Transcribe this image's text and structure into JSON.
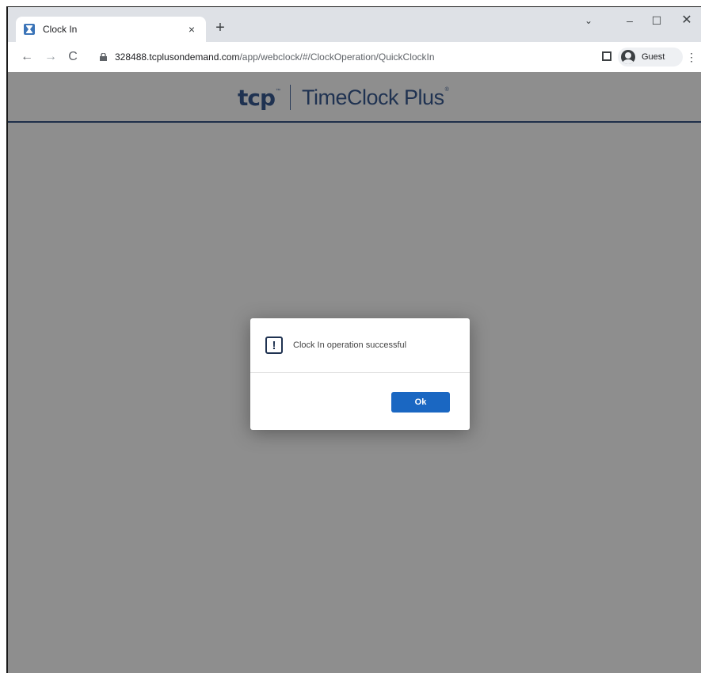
{
  "browser": {
    "tab": {
      "title": "Clock In",
      "close_glyph": "×",
      "favicon": "hourglass-icon"
    },
    "new_tab_glyph": "+",
    "window_controls": {
      "tab_search": "⌄",
      "minimize": "–",
      "maximize": "☐",
      "close": "✕"
    },
    "nav": {
      "back": "←",
      "forward": "→",
      "reload": "C"
    },
    "address": {
      "host": "328488.tcplusondemand.com",
      "path": "/app/webclock/#/ClockOperation/QuickClockIn"
    },
    "profile_label": "Guest",
    "menu_glyph": "⋮"
  },
  "header": {
    "logo_mark": "tcp",
    "logo_tm": "™",
    "logo_text": "TimeClock Plus",
    "logo_reg": "®"
  },
  "dialog": {
    "icon_glyph": "!",
    "message": "Clock In operation successful",
    "ok_label": "Ok"
  },
  "colors": {
    "overlay": "#8e8e8e",
    "brand_navy": "#1f3251",
    "button_blue": "#1a67c2"
  }
}
